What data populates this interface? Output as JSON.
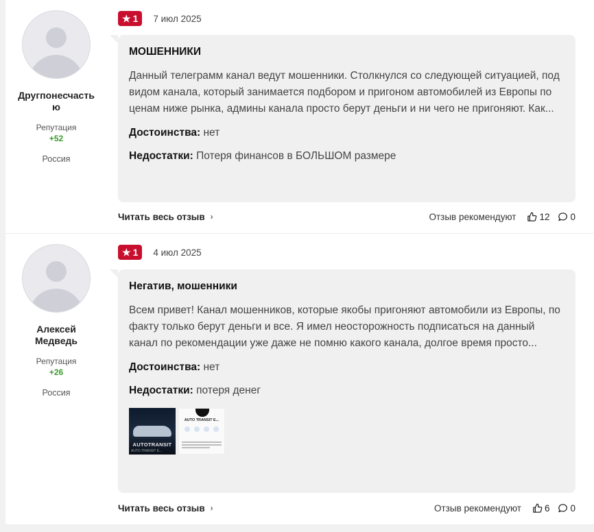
{
  "reviews": [
    {
      "author": {
        "name": "Другпонесчастью",
        "reputation_label": "Репутация",
        "reputation": "+52",
        "country": "Россия"
      },
      "rating": "1",
      "date": "7 июл 2025",
      "title": "МОШЕННИКИ",
      "text": "Данный телеграмм канал ведут мошенники. Столкнулся со следующей ситуацией, под видом канала, который занимается подбором и пригоном автомобилей из Европы по ценам ниже рынка, админы канала просто берут деньги и ни чего не пригоняют. Как...",
      "pros_label": "Достоинства:",
      "pros": "нет",
      "cons_label": "Недостатки:",
      "cons": "Потеря финансов в БОЛЬШОМ размере",
      "read_more": "Читать весь отзыв",
      "recommend_label": "Отзыв рекомендуют",
      "likes": "12",
      "comments": "0"
    },
    {
      "author": {
        "name": "Алексей Медведь",
        "reputation_label": "Репутация",
        "reputation": "+26",
        "country": "Россия"
      },
      "rating": "1",
      "date": "4 июл 2025",
      "title": "Негатив, мошенники",
      "text": "Всем привет! Канал мошенников, которые якобы пригоняют автомобили из Европы, по факту только берут деньги и все. Я имел неосторожность подписаться на данный канал по рекомендации уже даже не помню какого канала, долгое время просто...",
      "pros_label": "Достоинства:",
      "pros": "нет",
      "cons_label": "Недостатки:",
      "cons": "потеря денег",
      "thumbnails": [
        {
          "caption": "AUTOTRANSIT",
          "subcaption": "AUTO TRANSIT E..."
        },
        {
          "caption": "AUTO TRANSIT E..."
        }
      ],
      "read_more": "Читать весь отзыв",
      "recommend_label": "Отзыв рекомендуют",
      "likes": "6",
      "comments": "0"
    }
  ],
  "colors": {
    "rating_badge": "#c8102e",
    "reputation": "#3a9a2b",
    "bubble": "#f0f0f0"
  },
  "icons": [
    "star-icon",
    "thumbs-up-icon",
    "comment-icon",
    "chevron-right-icon"
  ]
}
